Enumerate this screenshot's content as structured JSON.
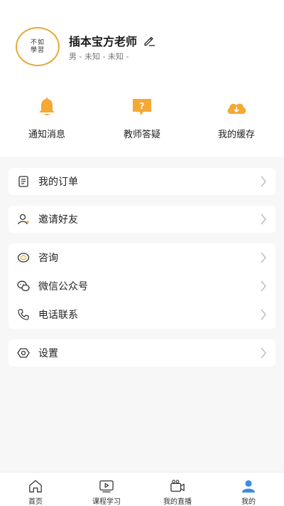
{
  "profile": {
    "avatar_text": "不如學習",
    "name": "插本宝方老师",
    "subline": "男 - 未知 - 未知 -"
  },
  "quick_actions": [
    {
      "label": "通知消息",
      "icon": "bell-icon"
    },
    {
      "label": "教师答疑",
      "icon": "question-chat-icon"
    },
    {
      "label": "我的缓存",
      "icon": "cloud-download-icon"
    }
  ],
  "menu": {
    "orders": "我的订单",
    "invite": "邀请好友",
    "consult": "咨询",
    "wechat": "微信公众号",
    "phone": "电话联系",
    "settings": "设置"
  },
  "tabs": [
    {
      "label": "首页",
      "icon": "home-icon"
    },
    {
      "label": "课程学习",
      "icon": "video-play-icon"
    },
    {
      "label": "我的直播",
      "icon": "camera-icon"
    },
    {
      "label": "我的",
      "icon": "user-icon",
      "active": true
    }
  ],
  "colors": {
    "accent": "#f5a833",
    "avatar_border": "#e6a93b",
    "active_tab": "#3d8be8",
    "background": "#f7f7f7"
  }
}
